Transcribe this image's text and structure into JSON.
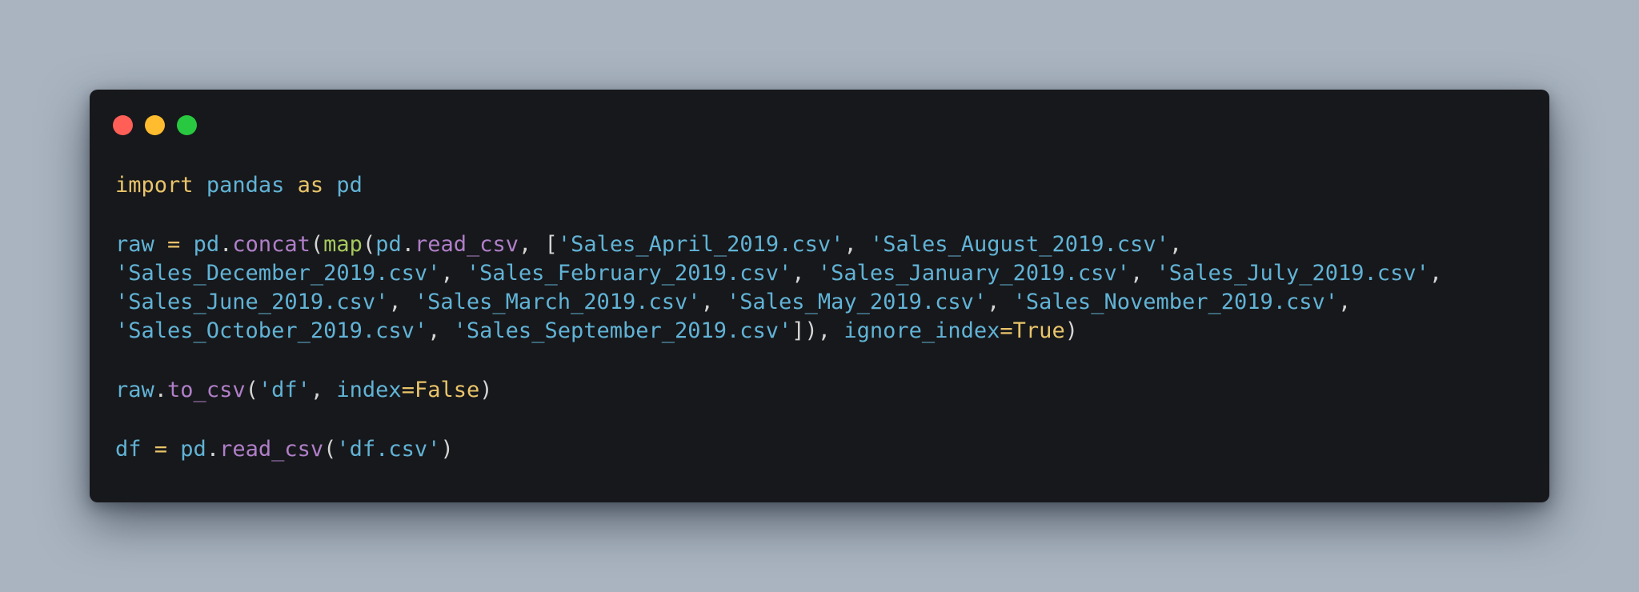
{
  "window": {
    "controls": {
      "close_color": "#ff5f57",
      "minimize_color": "#febc2e",
      "maximize_color": "#28c840"
    }
  },
  "code": {
    "language": "python",
    "line1": {
      "kw_import": "import",
      "module": "pandas",
      "kw_as": "as",
      "alias": "pd"
    },
    "line2": {
      "var": "raw",
      "eq": " = ",
      "obj": "pd",
      "dot": ".",
      "fn": "concat",
      "open": "(",
      "builtin": "map",
      "open2": "(",
      "obj2": "pd",
      "dot2": ".",
      "fn2": "read_csv",
      "sep": ", [",
      "file1": "'Sales_April_2019.csv'",
      "c1": ", ",
      "file2": "'Sales_August_2019.csv'",
      "c2": ","
    },
    "line3": {
      "file3": "'Sales_December_2019.csv'",
      "c1": ", ",
      "file4": "'Sales_February_2019.csv'",
      "c2": ", ",
      "file5": "'Sales_January_2019.csv'",
      "c3": ", ",
      "file6": "'Sales_July_2019.csv'",
      "c4": ","
    },
    "line4": {
      "file7": "'Sales_June_2019.csv'",
      "c1": ", ",
      "file8": "'Sales_March_2019.csv'",
      "c2": ", ",
      "file9": "'Sales_May_2019.csv'",
      "c3": ", ",
      "file10": "'Sales_November_2019.csv'",
      "c4": ","
    },
    "line5": {
      "file11": "'Sales_October_2019.csv'",
      "c1": ", ",
      "file12": "'Sales_September_2019.csv'",
      "close": "]), ",
      "kwarg": "ignore_index",
      "eq": "=",
      "value": "True",
      "end": ")"
    },
    "line6": {
      "var": "raw",
      "dot": ".",
      "fn": "to_csv",
      "open": "(",
      "arg": "'df'",
      "sep": ", ",
      "kwarg": "index",
      "eq": "=",
      "value": "False",
      "end": ")"
    },
    "line7": {
      "var": "df",
      "eq": " = ",
      "obj": "pd",
      "dot": ".",
      "fn": "read_csv",
      "open": "(",
      "arg": "'df.csv'",
      "end": ")"
    }
  }
}
